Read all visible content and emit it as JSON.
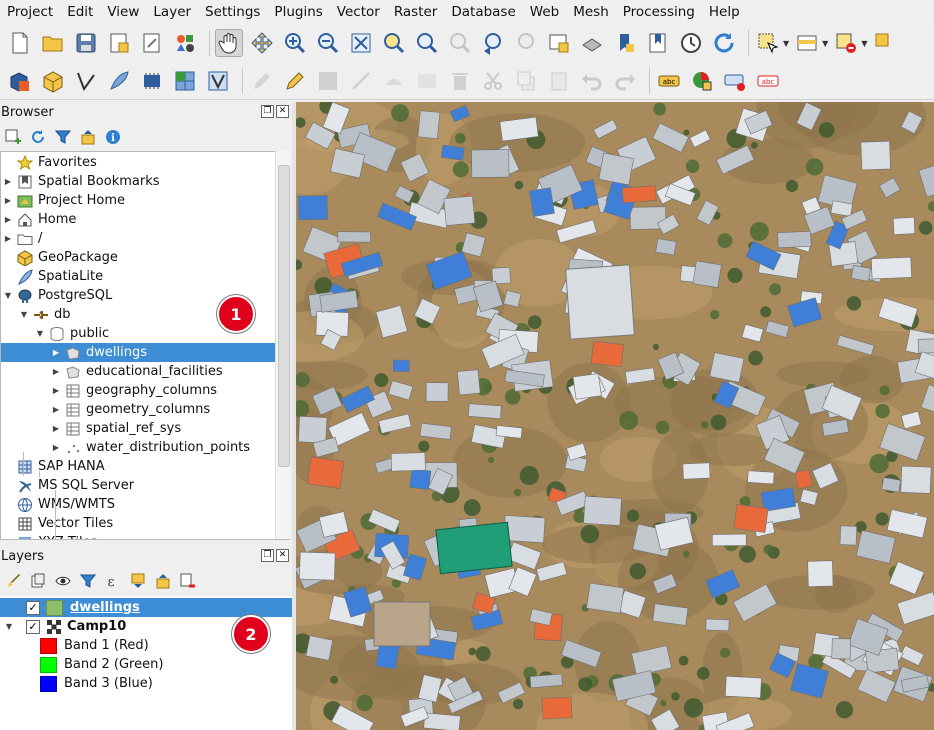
{
  "menu": [
    "Project",
    "Edit",
    "View",
    "Layer",
    "Settings",
    "Plugins",
    "Vector",
    "Raster",
    "Database",
    "Web",
    "Mesh",
    "Processing",
    "Help"
  ],
  "browser": {
    "title": "Browser",
    "items": [
      {
        "label": "Favorites",
        "icon": "star-icon",
        "arrow": "",
        "indent": 0
      },
      {
        "label": "Spatial Bookmarks",
        "icon": "bookmark-icon",
        "arrow": "▶",
        "indent": 0
      },
      {
        "label": "Project Home",
        "icon": "project-home-icon",
        "arrow": "▶",
        "indent": 0
      },
      {
        "label": "Home",
        "icon": "home-icon",
        "arrow": "▶",
        "indent": 0
      },
      {
        "label": "/",
        "icon": "folder-icon",
        "arrow": "▶",
        "indent": 0
      },
      {
        "label": "GeoPackage",
        "icon": "geopackage-icon",
        "arrow": "",
        "indent": 0
      },
      {
        "label": "SpatiaLite",
        "icon": "spatialite-icon",
        "arrow": "",
        "indent": 0
      },
      {
        "label": "PostgreSQL",
        "icon": "postgresql-icon",
        "arrow": "▼",
        "indent": 0
      },
      {
        "label": "db",
        "icon": "connection-icon",
        "arrow": "▼",
        "indent": 1
      },
      {
        "label": "public",
        "icon": "schema-icon",
        "arrow": "▼",
        "indent": 2
      },
      {
        "label": "dwellings",
        "icon": "polygon-layer-icon",
        "arrow": "▶",
        "indent": 3,
        "selected": true
      },
      {
        "label": "educational_facilities",
        "icon": "polygon-layer-icon",
        "arrow": "▶",
        "indent": 3
      },
      {
        "label": "geography_columns",
        "icon": "table-icon",
        "arrow": "▶",
        "indent": 3
      },
      {
        "label": "geometry_columns",
        "icon": "table-icon",
        "arrow": "▶",
        "indent": 3
      },
      {
        "label": "spatial_ref_sys",
        "icon": "table-icon",
        "arrow": "▶",
        "indent": 3
      },
      {
        "label": "water_distribution_points",
        "icon": "point-layer-icon",
        "arrow": "▶",
        "indent": 3
      },
      {
        "label": "SAP HANA",
        "icon": "sap-hana-icon",
        "arrow": "",
        "indent": 0
      },
      {
        "label": "MS SQL Server",
        "icon": "mssql-icon",
        "arrow": "",
        "indent": 0
      },
      {
        "label": "WMS/WMTS",
        "icon": "wms-icon",
        "arrow": "",
        "indent": 0
      },
      {
        "label": "Vector Tiles",
        "icon": "vector-tiles-icon",
        "arrow": "",
        "indent": 0
      },
      {
        "label": "XYZ Tiles",
        "icon": "xyz-tiles-icon",
        "arrow": "",
        "indent": 0
      }
    ]
  },
  "layers": {
    "title": "Layers",
    "items": [
      {
        "label": "dwellings",
        "checked": true,
        "swatch": "#8fbf6a",
        "selected": true,
        "bold": true,
        "underline": true,
        "arrow": "",
        "indent": 0
      },
      {
        "label": "Camp10",
        "checked": true,
        "icon": "raster-icon",
        "bold": true,
        "arrow": "▼",
        "indent": 0
      },
      {
        "label": "Band 1 (Red)",
        "swatch": "#ff0000",
        "indent": 1
      },
      {
        "label": "Band 2 (Green)",
        "swatch": "#00ff00",
        "indent": 1
      },
      {
        "label": "Band 3 (Blue)",
        "swatch": "#0000ff",
        "indent": 1
      }
    ]
  },
  "badges": {
    "one": "1",
    "two": "2"
  },
  "colors": {
    "selection": "#3c8dd4",
    "badge": "#e0001b"
  }
}
